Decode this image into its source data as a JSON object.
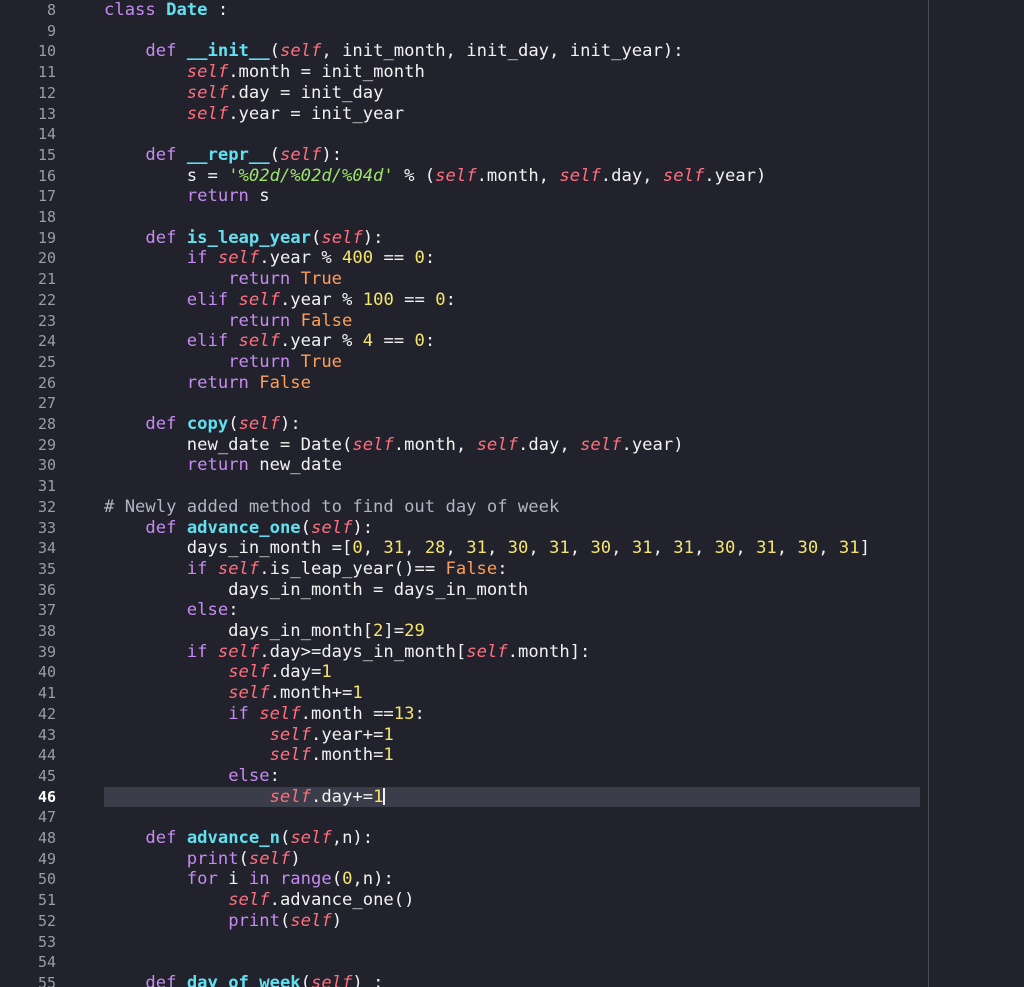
{
  "editor": {
    "current_line": 46,
    "colors": {
      "background": "#21222c",
      "current_line_bg": "#3b3d4a",
      "keyword": "#c68bf1",
      "function_name": "#62e0f0",
      "self": "#ff6f7d",
      "number": "#f5e56b",
      "string": "#9fe36a",
      "constant": "#ff9f57"
    }
  },
  "lines": [
    {
      "no": "8",
      "tokens": [
        [
          "kw2",
          "class "
        ],
        [
          "cls",
          "Date"
        ],
        [
          "plain",
          " :"
        ]
      ]
    },
    {
      "no": "9",
      "tokens": []
    },
    {
      "no": "10",
      "tokens": [
        [
          "plain",
          "    "
        ],
        [
          "kw2",
          "def "
        ],
        [
          "fn",
          "__init__"
        ],
        [
          "plain",
          "("
        ],
        [
          "self",
          "self"
        ],
        [
          "plain",
          ", init_month, init_day, init_year):"
        ]
      ]
    },
    {
      "no": "11",
      "tokens": [
        [
          "plain",
          "        "
        ],
        [
          "self",
          "self"
        ],
        [
          "plain",
          ".month = init_month"
        ]
      ]
    },
    {
      "no": "12",
      "tokens": [
        [
          "plain",
          "        "
        ],
        [
          "self",
          "self"
        ],
        [
          "plain",
          ".day = init_day"
        ]
      ]
    },
    {
      "no": "13",
      "tokens": [
        [
          "plain",
          "        "
        ],
        [
          "self",
          "self"
        ],
        [
          "plain",
          ".year = init_year"
        ]
      ]
    },
    {
      "no": "14",
      "tokens": []
    },
    {
      "no": "15",
      "tokens": [
        [
          "plain",
          "    "
        ],
        [
          "kw2",
          "def "
        ],
        [
          "fn",
          "__repr__"
        ],
        [
          "plain",
          "("
        ],
        [
          "self",
          "self"
        ],
        [
          "plain",
          "):"
        ]
      ]
    },
    {
      "no": "16",
      "tokens": [
        [
          "plain",
          "        s = "
        ],
        [
          "str",
          "'%02d/%02d/%04d'"
        ],
        [
          "plain",
          " % ("
        ],
        [
          "self",
          "self"
        ],
        [
          "plain",
          ".month, "
        ],
        [
          "self",
          "self"
        ],
        [
          "plain",
          ".day, "
        ],
        [
          "self",
          "self"
        ],
        [
          "plain",
          ".year)"
        ]
      ]
    },
    {
      "no": "17",
      "tokens": [
        [
          "plain",
          "        "
        ],
        [
          "kw2",
          "return"
        ],
        [
          "plain",
          " s"
        ]
      ]
    },
    {
      "no": "18",
      "tokens": []
    },
    {
      "no": "19",
      "tokens": [
        [
          "plain",
          "    "
        ],
        [
          "kw2",
          "def "
        ],
        [
          "fn",
          "is_leap_year"
        ],
        [
          "plain",
          "("
        ],
        [
          "self",
          "self"
        ],
        [
          "plain",
          "):"
        ]
      ]
    },
    {
      "no": "20",
      "tokens": [
        [
          "plain",
          "        "
        ],
        [
          "kw2",
          "if "
        ],
        [
          "self",
          "self"
        ],
        [
          "plain",
          ".year % "
        ],
        [
          "num",
          "400"
        ],
        [
          "plain",
          " == "
        ],
        [
          "num",
          "0"
        ],
        [
          "plain",
          ":"
        ]
      ]
    },
    {
      "no": "21",
      "tokens": [
        [
          "plain",
          "            "
        ],
        [
          "kw2",
          "return "
        ],
        [
          "const",
          "True"
        ]
      ]
    },
    {
      "no": "22",
      "tokens": [
        [
          "plain",
          "        "
        ],
        [
          "kw2",
          "elif "
        ],
        [
          "self",
          "self"
        ],
        [
          "plain",
          ".year % "
        ],
        [
          "num",
          "100"
        ],
        [
          "plain",
          " == "
        ],
        [
          "num",
          "0"
        ],
        [
          "plain",
          ":"
        ]
      ]
    },
    {
      "no": "23",
      "tokens": [
        [
          "plain",
          "            "
        ],
        [
          "kw2",
          "return "
        ],
        [
          "const",
          "False"
        ]
      ]
    },
    {
      "no": "24",
      "tokens": [
        [
          "plain",
          "        "
        ],
        [
          "kw2",
          "elif "
        ],
        [
          "self",
          "self"
        ],
        [
          "plain",
          ".year % "
        ],
        [
          "num",
          "4"
        ],
        [
          "plain",
          " == "
        ],
        [
          "num",
          "0"
        ],
        [
          "plain",
          ":"
        ]
      ]
    },
    {
      "no": "25",
      "tokens": [
        [
          "plain",
          "            "
        ],
        [
          "kw2",
          "return "
        ],
        [
          "const",
          "True"
        ]
      ]
    },
    {
      "no": "26",
      "tokens": [
        [
          "plain",
          "        "
        ],
        [
          "kw2",
          "return "
        ],
        [
          "const",
          "False"
        ]
      ]
    },
    {
      "no": "27",
      "tokens": []
    },
    {
      "no": "28",
      "tokens": [
        [
          "plain",
          "    "
        ],
        [
          "kw2",
          "def "
        ],
        [
          "fn",
          "copy"
        ],
        [
          "plain",
          "("
        ],
        [
          "self",
          "self"
        ],
        [
          "plain",
          "):"
        ]
      ]
    },
    {
      "no": "29",
      "tokens": [
        [
          "plain",
          "        new_date = Date("
        ],
        [
          "self",
          "self"
        ],
        [
          "plain",
          ".month, "
        ],
        [
          "self",
          "self"
        ],
        [
          "plain",
          ".day, "
        ],
        [
          "self",
          "self"
        ],
        [
          "plain",
          ".year)"
        ]
      ]
    },
    {
      "no": "30",
      "tokens": [
        [
          "plain",
          "        "
        ],
        [
          "kw2",
          "return"
        ],
        [
          "plain",
          " new_date"
        ]
      ]
    },
    {
      "no": "31",
      "tokens": []
    },
    {
      "no": "32",
      "tokens": [
        [
          "cmt",
          "# Newly added method to find out day of week"
        ]
      ]
    },
    {
      "no": "33",
      "tokens": [
        [
          "plain",
          "    "
        ],
        [
          "kw2",
          "def "
        ],
        [
          "fn",
          "advance_one"
        ],
        [
          "plain",
          "("
        ],
        [
          "self",
          "self"
        ],
        [
          "plain",
          "):"
        ]
      ]
    },
    {
      "no": "34",
      "tokens": [
        [
          "plain",
          "        days_in_month =["
        ],
        [
          "num",
          "0"
        ],
        [
          "plain",
          ", "
        ],
        [
          "num",
          "31"
        ],
        [
          "plain",
          ", "
        ],
        [
          "num",
          "28"
        ],
        [
          "plain",
          ", "
        ],
        [
          "num",
          "31"
        ],
        [
          "plain",
          ", "
        ],
        [
          "num",
          "30"
        ],
        [
          "plain",
          ", "
        ],
        [
          "num",
          "31"
        ],
        [
          "plain",
          ", "
        ],
        [
          "num",
          "30"
        ],
        [
          "plain",
          ", "
        ],
        [
          "num",
          "31"
        ],
        [
          "plain",
          ", "
        ],
        [
          "num",
          "31"
        ],
        [
          "plain",
          ", "
        ],
        [
          "num",
          "30"
        ],
        [
          "plain",
          ", "
        ],
        [
          "num",
          "31"
        ],
        [
          "plain",
          ", "
        ],
        [
          "num",
          "30"
        ],
        [
          "plain",
          ", "
        ],
        [
          "num",
          "31"
        ],
        [
          "plain",
          "]"
        ]
      ]
    },
    {
      "no": "35",
      "tokens": [
        [
          "plain",
          "        "
        ],
        [
          "kw2",
          "if "
        ],
        [
          "self",
          "self"
        ],
        [
          "plain",
          ".is_leap_year()== "
        ],
        [
          "const",
          "False"
        ],
        [
          "plain",
          ":"
        ]
      ]
    },
    {
      "no": "36",
      "tokens": [
        [
          "plain",
          "            days_in_month = days_in_month"
        ]
      ]
    },
    {
      "no": "37",
      "tokens": [
        [
          "plain",
          "        "
        ],
        [
          "kw2",
          "else"
        ],
        [
          "plain",
          ":"
        ]
      ]
    },
    {
      "no": "38",
      "tokens": [
        [
          "plain",
          "            days_in_month["
        ],
        [
          "num",
          "2"
        ],
        [
          "plain",
          "]="
        ],
        [
          "num",
          "29"
        ]
      ]
    },
    {
      "no": "39",
      "tokens": [
        [
          "plain",
          "        "
        ],
        [
          "kw2",
          "if "
        ],
        [
          "self",
          "self"
        ],
        [
          "plain",
          ".day>=days_in_month["
        ],
        [
          "self",
          "self"
        ],
        [
          "plain",
          ".month]:"
        ]
      ]
    },
    {
      "no": "40",
      "tokens": [
        [
          "plain",
          "            "
        ],
        [
          "self",
          "self"
        ],
        [
          "plain",
          ".day="
        ],
        [
          "num",
          "1"
        ]
      ]
    },
    {
      "no": "41",
      "tokens": [
        [
          "plain",
          "            "
        ],
        [
          "self",
          "self"
        ],
        [
          "plain",
          ".month+="
        ],
        [
          "num",
          "1"
        ]
      ]
    },
    {
      "no": "42",
      "tokens": [
        [
          "plain",
          "            "
        ],
        [
          "kw2",
          "if "
        ],
        [
          "self",
          "self"
        ],
        [
          "plain",
          ".month =="
        ],
        [
          "num",
          "13"
        ],
        [
          "plain",
          ":"
        ]
      ]
    },
    {
      "no": "43",
      "tokens": [
        [
          "plain",
          "                "
        ],
        [
          "self",
          "self"
        ],
        [
          "plain",
          ".year+="
        ],
        [
          "num",
          "1"
        ]
      ]
    },
    {
      "no": "44",
      "tokens": [
        [
          "plain",
          "                "
        ],
        [
          "self",
          "self"
        ],
        [
          "plain",
          ".month="
        ],
        [
          "num",
          "1"
        ]
      ]
    },
    {
      "no": "45",
      "tokens": [
        [
          "plain",
          "            "
        ],
        [
          "kw2",
          "else"
        ],
        [
          "plain",
          ":"
        ]
      ]
    },
    {
      "no": "46",
      "tokens": [
        [
          "plain",
          "                "
        ],
        [
          "self",
          "self"
        ],
        [
          "plain",
          ".day+="
        ],
        [
          "num",
          "1"
        ]
      ],
      "current": true
    },
    {
      "no": "47",
      "tokens": []
    },
    {
      "no": "48",
      "tokens": [
        [
          "plain",
          "    "
        ],
        [
          "kw2",
          "def "
        ],
        [
          "fn",
          "advance_n"
        ],
        [
          "plain",
          "("
        ],
        [
          "self",
          "self"
        ],
        [
          "plain",
          ",n):"
        ]
      ]
    },
    {
      "no": "49",
      "tokens": [
        [
          "plain",
          "        "
        ],
        [
          "kw2",
          "print"
        ],
        [
          "plain",
          "("
        ],
        [
          "self",
          "self"
        ],
        [
          "plain",
          ")"
        ]
      ]
    },
    {
      "no": "50",
      "tokens": [
        [
          "plain",
          "        "
        ],
        [
          "kw2",
          "for"
        ],
        [
          "plain",
          " i "
        ],
        [
          "kw2",
          "in"
        ],
        [
          "plain",
          " "
        ],
        [
          "kw2",
          "range"
        ],
        [
          "plain",
          "("
        ],
        [
          "num",
          "0"
        ],
        [
          "plain",
          ",n):"
        ]
      ]
    },
    {
      "no": "51",
      "tokens": [
        [
          "plain",
          "            "
        ],
        [
          "self",
          "self"
        ],
        [
          "plain",
          ".advance_one()"
        ]
      ]
    },
    {
      "no": "52",
      "tokens": [
        [
          "plain",
          "            "
        ],
        [
          "kw2",
          "print"
        ],
        [
          "plain",
          "("
        ],
        [
          "self",
          "self"
        ],
        [
          "plain",
          ")"
        ]
      ]
    },
    {
      "no": "53",
      "tokens": []
    },
    {
      "no": "54",
      "tokens": []
    },
    {
      "no": "55",
      "tokens": [
        [
          "plain",
          "    "
        ],
        [
          "kw2",
          "def "
        ],
        [
          "fn",
          "day_of_week"
        ],
        [
          "plain",
          "("
        ],
        [
          "self",
          "self"
        ],
        [
          "plain",
          ") :"
        ]
      ]
    }
  ]
}
